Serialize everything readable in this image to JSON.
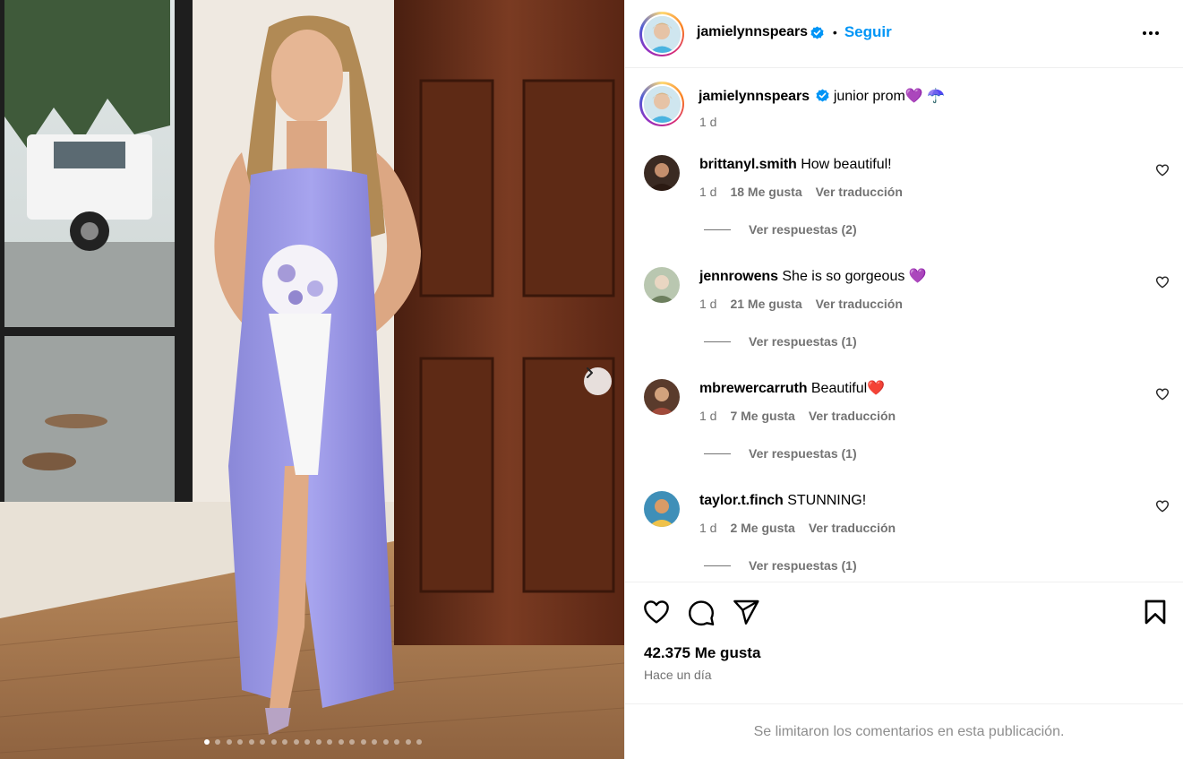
{
  "photo": {
    "description_icon": "photo",
    "dot_count": 20,
    "active_dot": 0
  },
  "header": {
    "username": "jamielynnspears",
    "separator": "•",
    "follow_label": "Seguir"
  },
  "caption": {
    "username": "jamielynnspears",
    "text": "junior prom",
    "emoji": "💜 ☂️",
    "time": "1 d"
  },
  "comments": [
    {
      "username": "brittanyl.smith",
      "text": "How beautiful!",
      "time": "1 d",
      "likes": "18 Me gusta",
      "translate": "Ver traducción",
      "replies": "Ver respuestas (2)"
    },
    {
      "username": "jennrowens",
      "text": "She is so gorgeous 💜",
      "time": "1 d",
      "likes": "21 Me gusta",
      "translate": "Ver traducción",
      "replies": "Ver respuestas (1)"
    },
    {
      "username": "mbrewercarruth",
      "text": "Beautiful❤️",
      "time": "1 d",
      "likes": "7 Me gusta",
      "translate": "Ver traducción",
      "replies": "Ver respuestas (1)"
    },
    {
      "username": "taylor.t.finch",
      "text": "STUNNING!",
      "time": "1 d",
      "likes": "2 Me gusta",
      "translate": "Ver traducción",
      "replies": "Ver respuestas (1)"
    }
  ],
  "actions": {
    "likes": "42.375 Me gusta",
    "time": "Hace un día"
  },
  "footer": {
    "text": "Se limitaron los comentarios en esta publicación."
  },
  "colors": {
    "accent": "#0095f6",
    "verified": "#0095f6",
    "muted": "#737373"
  }
}
